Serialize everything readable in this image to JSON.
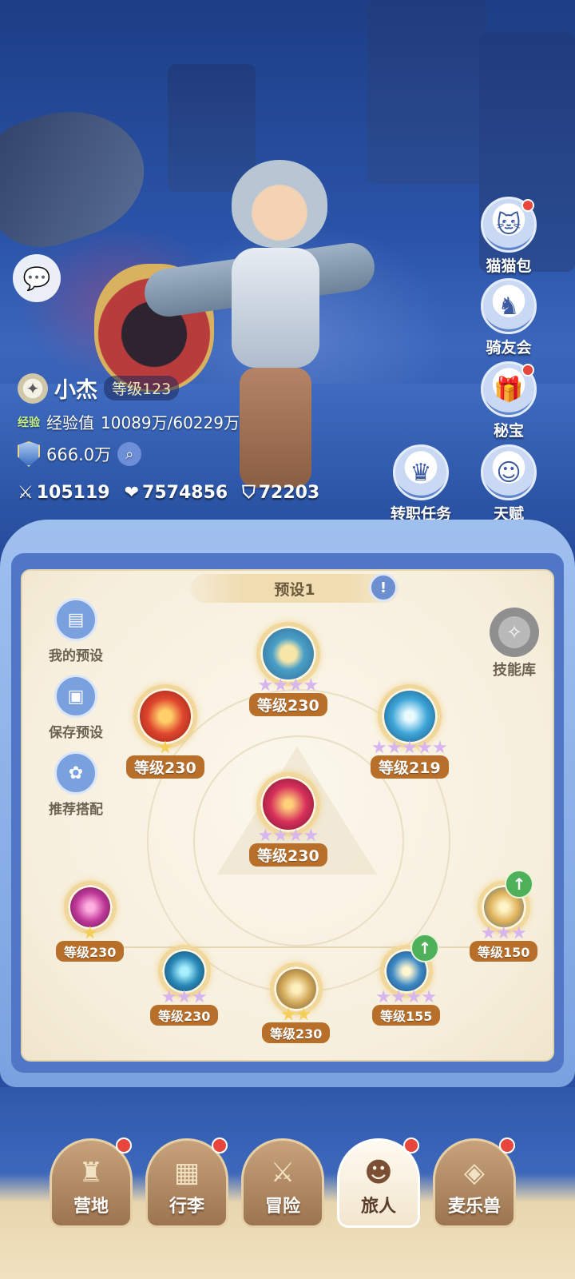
{
  "player": {
    "name": "小杰",
    "level": "等级123",
    "exp_tag": "经验",
    "exp_label": "经验值",
    "exp_value": "10089万/60229万",
    "power": "666.0万",
    "attack": "105119",
    "hp": "7574856",
    "defense": "72203"
  },
  "side_menu": [
    {
      "label": "猫猫包",
      "icon": "cat-bag-icon",
      "badge": true
    },
    {
      "label": "骑友会",
      "icon": "horse-icon",
      "badge": false
    },
    {
      "label": "秘宝",
      "icon": "treasure-icon",
      "badge": true
    },
    {
      "label": "天赋",
      "icon": "talent-head-icon",
      "badge": false
    }
  ],
  "job_quest": {
    "label": "转职任务",
    "icon": "crown-icon"
  },
  "panel": {
    "preset_title": "预设1",
    "skill_library": "技能库",
    "actions": [
      "我的预设",
      "保存预设",
      "推荐搭配"
    ]
  },
  "skills": [
    {
      "level": "等级230",
      "stars": 4,
      "star_color": "purple"
    },
    {
      "level": "等级230",
      "stars": 1,
      "star_color": "gold"
    },
    {
      "level": "等级219",
      "stars": 5,
      "star_color": "purple"
    },
    {
      "level": "等级230",
      "stars": 4,
      "star_color": "purple"
    },
    {
      "level": "等级230",
      "stars": 1,
      "star_color": "gold"
    },
    {
      "level": "等级230",
      "stars": 3,
      "star_color": "purple"
    },
    {
      "level": "等级230",
      "stars": 2,
      "star_color": "gold"
    },
    {
      "level": "等级155",
      "stars": 4,
      "star_color": "purple",
      "upgrade": true
    },
    {
      "level": "等级150",
      "stars": 3,
      "star_color": "purple",
      "upgrade": true
    }
  ],
  "bottom_nav": [
    {
      "label": "营地",
      "icon": "castle-icon",
      "badge": true,
      "active": false
    },
    {
      "label": "行李",
      "icon": "chest-icon",
      "badge": true,
      "active": false
    },
    {
      "label": "冒险",
      "icon": "swords-icon",
      "badge": false,
      "active": false
    },
    {
      "label": "旅人",
      "icon": "traveler-icon",
      "badge": true,
      "active": true
    },
    {
      "label": "麦乐兽",
      "icon": "fox-icon",
      "badge": true,
      "active": false
    }
  ],
  "colors": {
    "accent_blue": "#4f77c6",
    "level_badge": "#b86f2a",
    "badge_red": "#e8463c",
    "panel_bg": "#f7efdd"
  }
}
